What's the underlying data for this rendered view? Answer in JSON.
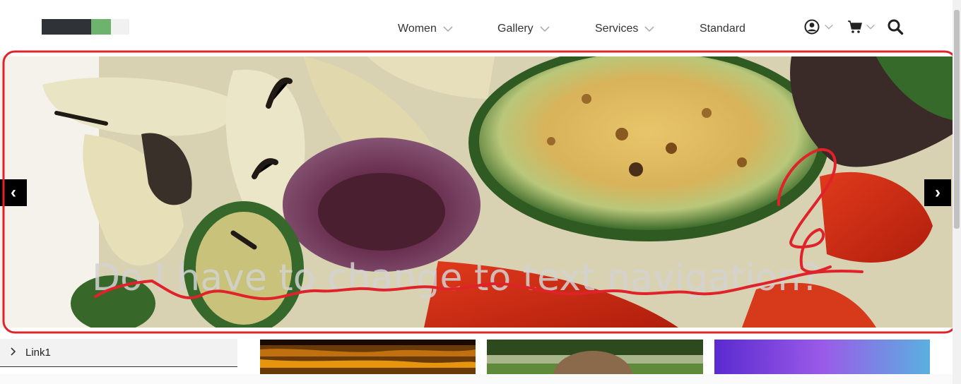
{
  "header": {
    "logo_name": "site-logo",
    "nav": [
      {
        "label": "Women",
        "has_dropdown": true
      },
      {
        "label": "Gallery",
        "has_dropdown": true
      },
      {
        "label": "Services",
        "has_dropdown": true
      },
      {
        "label": "Standard",
        "has_dropdown": false
      }
    ],
    "icons": [
      "user-icon",
      "cart-icon",
      "search-icon"
    ]
  },
  "hero": {
    "caption": "Do I have to change to text navigation?",
    "prev_label": "‹",
    "next_label": "›",
    "annotation_color": "#e0232b"
  },
  "sidebar": {
    "links": [
      {
        "label": "Link1"
      }
    ]
  },
  "colors": {
    "logo_dark": "#2f3338",
    "logo_green": "#6db36d",
    "logo_light": "#f1f1f1",
    "nav_text": "#333333",
    "chevron": "#b0b0b0"
  }
}
